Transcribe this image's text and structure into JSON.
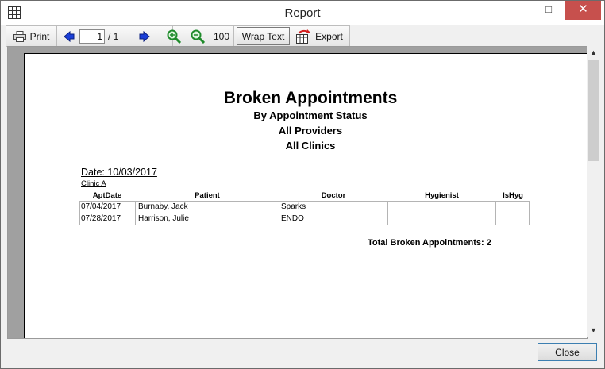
{
  "window": {
    "title": "Report",
    "minimize_glyph": "—",
    "maximize_glyph": "□",
    "close_glyph": "✕"
  },
  "toolbar": {
    "print_label": "Print",
    "page_current": "1",
    "page_total": "/ 1",
    "zoom_100_label": "100",
    "wrap_text_label": "Wrap Text",
    "export_label": "Export",
    "icons": [
      "printer-icon",
      "arrow-left-icon",
      "arrow-right-icon",
      "zoom-in-icon",
      "zoom-out-icon",
      "export-icon"
    ]
  },
  "report": {
    "title": "Broken Appointments",
    "subtitle_status": "By Appointment Status",
    "subtitle_providers": "All Providers",
    "subtitle_clinics": "All Clinics",
    "date_label": "Date: 10/03/2017",
    "clinic_label": "Clinic A",
    "columns": [
      "AptDate",
      "Patient",
      "Doctor",
      "Hygienist",
      "IsHyg"
    ],
    "rows": [
      [
        "07/04/2017",
        "Burnaby, Jack",
        "Sparks",
        "",
        ""
      ],
      [
        "07/28/2017",
        "Harrison, Julie",
        "ENDO",
        "",
        ""
      ]
    ],
    "total_label": "Total Broken Appointments: 2"
  },
  "footer": {
    "close_label": "Close"
  },
  "colors": {
    "nav_arrow": "#1a3fd8",
    "zoom_icon": "#1e8a2a",
    "close_button_bg": "#c7504d",
    "close_button_border": "#3c7fb1"
  }
}
